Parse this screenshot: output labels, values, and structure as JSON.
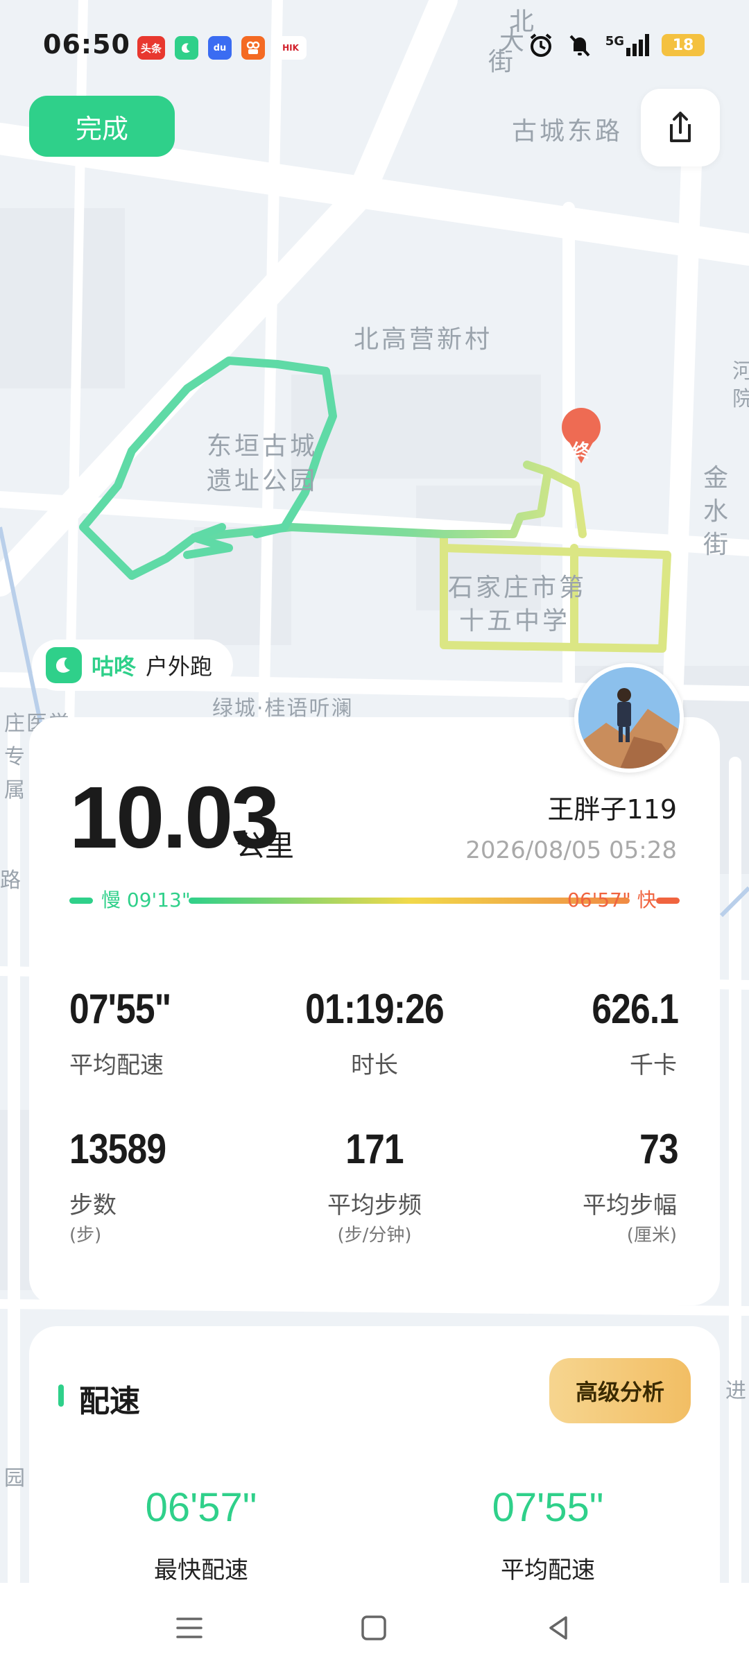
{
  "status_bar": {
    "time": "06:50",
    "app_icons": [
      {
        "name": "toutiao-icon",
        "label": "头条",
        "color": "#e8382f"
      },
      {
        "name": "gudong-app-icon",
        "label": "",
        "color": "#2fd08a"
      },
      {
        "name": "baidu-icon",
        "label": "du",
        "color": "#3a6cf2"
      },
      {
        "name": "kuaishou-icon",
        "label": "",
        "color": "#f46a23"
      },
      {
        "name": "hikvision-icon",
        "label": "HIK",
        "color": "#d11f2a"
      }
    ],
    "network": "5G",
    "battery": "18"
  },
  "header": {
    "done_label": "完成"
  },
  "map": {
    "labels": {
      "gucheng_east_road": "古城东路",
      "beigao_ying": "北高营新村",
      "dongyuan_1": "东垣古城",
      "dongyuan_2": "遗址公园",
      "school_1": "石家庄市第",
      "school_2": "十五中学",
      "jinshui_1": "金",
      "jinshui_2": "水",
      "jinshui_3": "街",
      "beida_1": "北",
      "beida_2": "大",
      "beida_3": "街",
      "lvcheng": "绿城·桂语听澜",
      "zhuang_1": "庄医学",
      "zhuang_2": "专",
      "zhuang_3": "属",
      "road_left": "路",
      "jin_right": "进",
      "yuan_left": "园",
      "he_1": "河",
      "he_2": "院",
      "end_marker": "终"
    },
    "route_color_fast": "#2fd08a",
    "route_color_slow": "#dbe684"
  },
  "brand": {
    "name": "咕咚",
    "activity": "户外跑"
  },
  "summary": {
    "distance": "10.03",
    "distance_unit": "公里",
    "username": "王胖子119",
    "datetime": "2026/08/05 05:28",
    "pace_slow": "慢 09'13\"",
    "pace_fast": "06'57\" 快"
  },
  "stats": [
    {
      "value": "07'55\"",
      "label": "平均配速",
      "unit": ""
    },
    {
      "value": "01:19:26",
      "label": "时长",
      "unit": ""
    },
    {
      "value": "626.1",
      "label": "千卡",
      "unit": ""
    },
    {
      "value": "13589",
      "label": "步数",
      "unit": "(步)"
    },
    {
      "value": "171",
      "label": "平均步频",
      "unit": "(步/分钟)"
    },
    {
      "value": "73",
      "label": "平均步幅",
      "unit": "(厘米)"
    }
  ],
  "pace_section": {
    "title": "配速",
    "advanced_label": "高级分析",
    "fastest_value": "06'57\"",
    "fastest_label": "最快配速",
    "average_value": "07'55\"",
    "average_label": "平均配速"
  }
}
